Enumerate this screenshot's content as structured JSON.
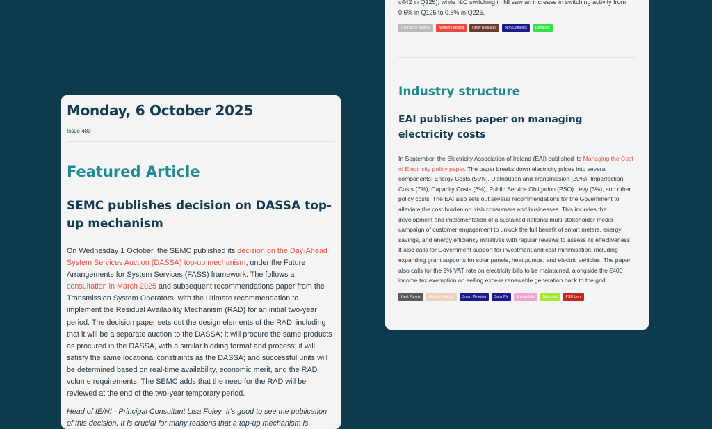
{
  "left": {
    "date": "Monday, 6 October 2025",
    "issue": "Issue 480",
    "section": "Featured Article",
    "article": {
      "title": "SEMC publishes decision on DASSA top-up mechanism",
      "p1_a": "On Wednesday 1 October, the SEMC published its ",
      "p1_link1": "decision on the Day-Ahead System Services Auction (DASSA) top-up mechanism",
      "p1_b": ", under the Future Arrangements for System Services (FASS) framework. The follows a ",
      "p1_link2": "consultation in March 2025",
      "p1_c": " and subsequent recommendations paper from the Transmission System Operators, with the ultimate recommendation to implement the Residual Availability Mechanism (RAD) for an initial two-year period. The decision paper sets out the design elements of the RAD, including that it will be a separate auction to the DASSA; it will procure the same products as procured in the DASSA, with a similar bidding format and process; it will satisfy the same locational constraints as the DASSA; and successful units will be determined based on real-time availability, economic merit, and the RAD volume requirements. The SEMC adds that the need for the RAD will be reviewed at the end of the two-year temporary period.",
      "p2": "Head of IE/NI - Principal Consultant Lisa Foley: It's good to see the publication of this decision. It is crucial for many reasons that a top-up mechanism is available for System"
    }
  },
  "right": {
    "top_text": "c442 in Q125), while I&C switching in NI saw an increase in switching activity from 0.6% in Q125 to 0.8% in Q225.",
    "tags1": [
      {
        "label": "Change of supplier",
        "color": "#b8b8b8"
      },
      {
        "label": "Northern Ireland",
        "color": "#e8483f"
      },
      {
        "label": "Utility Regulator",
        "color": "#6b3a2e"
      },
      {
        "label": "Non-Domestic",
        "color": "#1a1a8c"
      },
      {
        "label": "Domestic",
        "color": "#33e04a"
      }
    ],
    "section": "Industry structure",
    "article": {
      "title": "EAI publishes paper on managing electricity costs",
      "p1_a": "In September, the Electricity Association of Ireland (EAI) published its ",
      "p1_link": "Managing the Cost of Electricity policy paper",
      "p1_b": ". The paper breaks down electricity prices into several components: Energy Costs (55%), Distribution and Transmission (29%), Imperfection Costs (7%), Capacity Costs (6%), Public Service Obligation (PSO) Levy (3%), and other policy costs. The EAI also sets out several recommendations for the Government to alleviate the cost burden on Irish consumers and businesses. This includes the development and implementation of a sustained national multi-stakeholder media campaign of customer engagement to unlock the full benefit of smart meters, energy savings, and energy efficiency initiatives with regular reviews to assess its effectiveness. It also calls for Government support for investment and cost minimisation, including expanding grant supports for solar panels, heat pumps, and electric vehicles. The paper also calls for the 9% VAT rate on electricity bills to be maintained, alongside the €400 income tax exemption on selling excess renewable generation back to the grid."
    },
    "tags2": [
      {
        "label": "Heat Pumps",
        "color": "#5a5a5a"
      },
      {
        "label": "Electric Vehicles",
        "color": "#e8d2c0"
      },
      {
        "label": "Smart Metering",
        "color": "#1a1a8c"
      },
      {
        "label": "Solar PV",
        "color": "#1a1a8c"
      },
      {
        "label": "Energy bills",
        "color": "#f2a6d8"
      },
      {
        "label": "Networks",
        "color": "#a6e82e"
      },
      {
        "label": "PSO Levy",
        "color": "#c4261e"
      }
    ]
  }
}
